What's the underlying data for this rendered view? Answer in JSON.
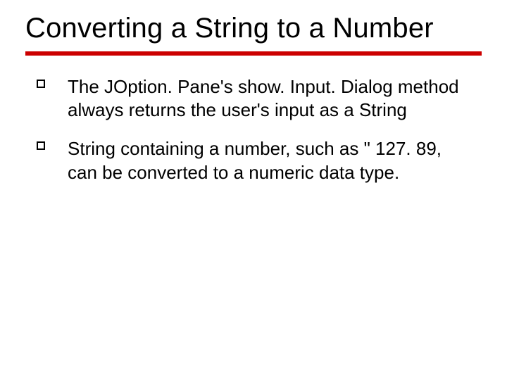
{
  "slide": {
    "title": "Converting a String to a Number",
    "bullets": [
      "The JOption. Pane's  show. Input. Dialog method always returns the user's input as a String",
      "String containing a number, such as \" 127. 89, can be converted to a numeric data type."
    ]
  }
}
